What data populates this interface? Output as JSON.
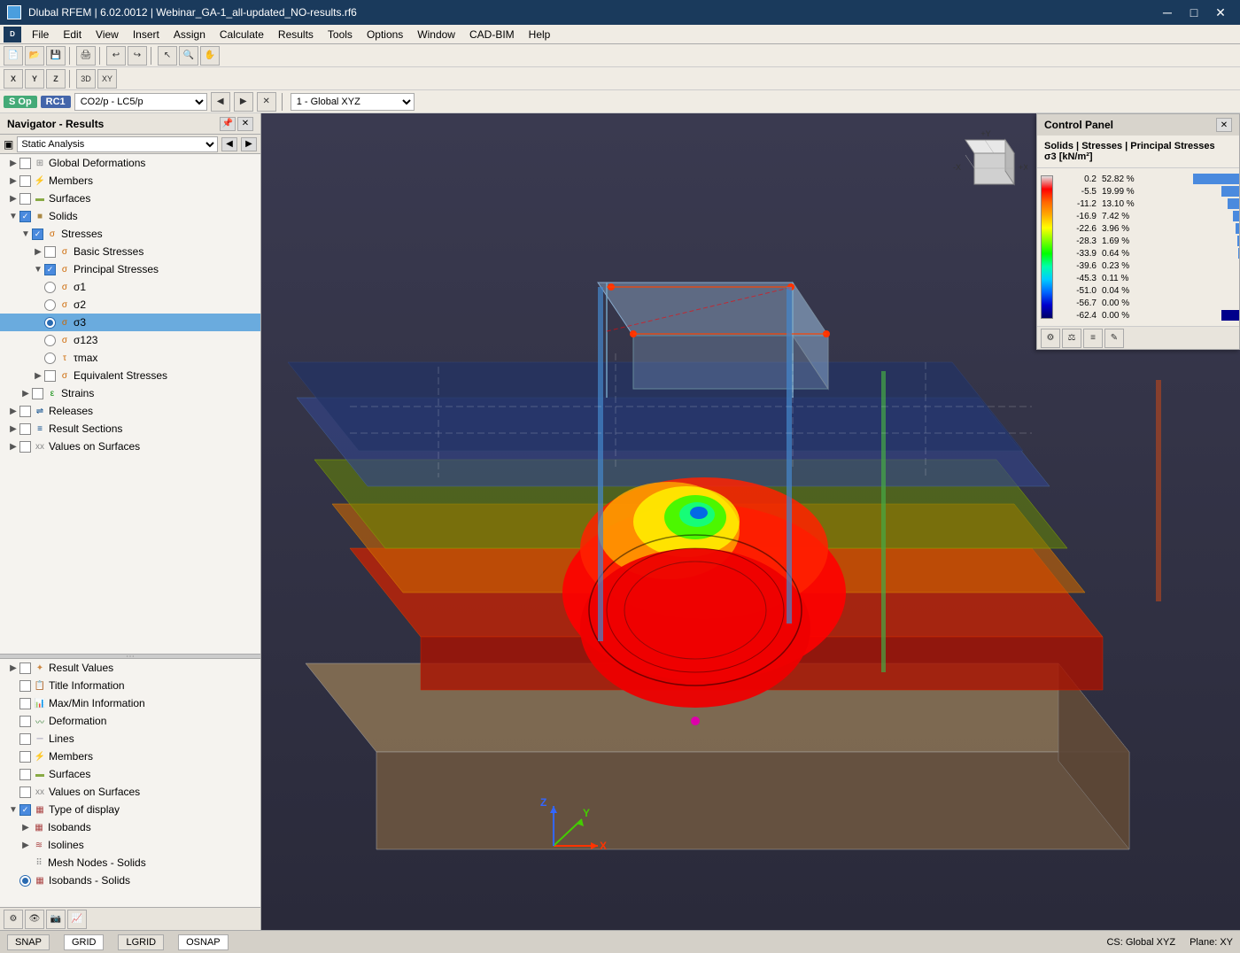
{
  "titlebar": {
    "title": "Dlubal RFEM | 6.02.0012 | Webinar_GA-1_all-updated_NO-results.rf6",
    "icon": "rfem-icon"
  },
  "menubar": {
    "items": [
      "File",
      "Edit",
      "View",
      "Insert",
      "Assign",
      "Calculate",
      "Results",
      "Tools",
      "Options",
      "Window",
      "CAD-BIM",
      "Help"
    ]
  },
  "status_toolbar": {
    "s_op": "S Op",
    "rc1": "RC1",
    "combo": "CO2/p - LC5/p",
    "global_xyz": "1 - Global XYZ"
  },
  "navigator": {
    "title": "Navigator - Results",
    "dropdown": "Static Analysis",
    "tree": [
      {
        "id": "global-def",
        "label": "Global Deformations",
        "indent": 1,
        "type": "checkbox",
        "checked": false,
        "icon": "grid"
      },
      {
        "id": "members",
        "label": "Members",
        "indent": 1,
        "type": "checkbox",
        "checked": false,
        "icon": "members"
      },
      {
        "id": "surfaces",
        "label": "Surfaces",
        "indent": 1,
        "type": "checkbox",
        "checked": false,
        "icon": "surface"
      },
      {
        "id": "solids",
        "label": "Solids",
        "indent": 1,
        "type": "checkbox",
        "checked": true,
        "icon": "solid",
        "expanded": true
      },
      {
        "id": "stresses",
        "label": "Stresses",
        "indent": 2,
        "type": "checkbox",
        "checked": true,
        "icon": "stress",
        "expanded": true
      },
      {
        "id": "basic-stress",
        "label": "Basic Stresses",
        "indent": 3,
        "type": "checkbox",
        "checked": false,
        "icon": "stress"
      },
      {
        "id": "principal-stress",
        "label": "Principal Stresses",
        "indent": 3,
        "type": "checkbox",
        "checked": true,
        "icon": "stress",
        "expanded": true
      },
      {
        "id": "s1",
        "label": "σ1",
        "indent": 4,
        "type": "radio",
        "checked": false,
        "icon": "stress"
      },
      {
        "id": "s2",
        "label": "σ2",
        "indent": 4,
        "type": "radio",
        "checked": false,
        "icon": "stress"
      },
      {
        "id": "s3",
        "label": "σ3",
        "indent": 4,
        "type": "radio",
        "checked": true,
        "icon": "stress"
      },
      {
        "id": "s123",
        "label": "σ123",
        "indent": 4,
        "type": "radio",
        "checked": false,
        "icon": "stress"
      },
      {
        "id": "tmax",
        "label": "τmax",
        "indent": 4,
        "type": "radio",
        "checked": false,
        "icon": "stress"
      },
      {
        "id": "equiv-stress",
        "label": "Equivalent Stresses",
        "indent": 3,
        "type": "checkbox",
        "checked": false,
        "icon": "stress"
      },
      {
        "id": "strains",
        "label": "Strains",
        "indent": 2,
        "type": "checkbox",
        "checked": false,
        "icon": "strain"
      },
      {
        "id": "releases",
        "label": "Releases",
        "indent": 1,
        "type": "checkbox",
        "checked": false,
        "icon": "result"
      },
      {
        "id": "result-sections",
        "label": "Result Sections",
        "indent": 1,
        "type": "checkbox",
        "checked": false,
        "icon": "result"
      },
      {
        "id": "values-on-surfaces",
        "label": "Values on Surfaces",
        "indent": 1,
        "type": "checkbox",
        "checked": false,
        "icon": "result"
      }
    ],
    "bottom_tree": [
      {
        "id": "result-values",
        "label": "Result Values",
        "indent": 1,
        "type": "checkbox",
        "checked": false,
        "icon": "result"
      },
      {
        "id": "title-info",
        "label": "Title Information",
        "indent": 1,
        "type": "checkbox",
        "checked": false,
        "icon": "title"
      },
      {
        "id": "maxmin-info",
        "label": "Max/Min Information",
        "indent": 1,
        "type": "checkbox",
        "checked": false,
        "icon": "info"
      },
      {
        "id": "deformation",
        "label": "Deformation",
        "indent": 1,
        "type": "checkbox",
        "checked": false,
        "icon": "deform"
      },
      {
        "id": "lines",
        "label": "Lines",
        "indent": 1,
        "type": "checkbox",
        "checked": false,
        "icon": "lines"
      },
      {
        "id": "members-b",
        "label": "Members",
        "indent": 1,
        "type": "checkbox",
        "checked": false,
        "icon": "members"
      },
      {
        "id": "surfaces-b",
        "label": "Surfaces",
        "indent": 1,
        "type": "checkbox",
        "checked": false,
        "icon": "surface"
      },
      {
        "id": "values-on-surfaces-b",
        "label": "Values on Surfaces",
        "indent": 1,
        "type": "checkbox",
        "checked": false,
        "icon": "result"
      },
      {
        "id": "type-of-display",
        "label": "Type of display",
        "indent": 1,
        "type": "checkbox",
        "checked": true,
        "icon": "display",
        "expanded": true
      },
      {
        "id": "isobands",
        "label": "Isobands",
        "indent": 2,
        "type": "item",
        "icon": "isoband"
      },
      {
        "id": "isolines",
        "label": "Isolines",
        "indent": 2,
        "type": "item",
        "icon": "isoline"
      },
      {
        "id": "mesh-nodes-solids",
        "label": "Mesh Nodes - Solids",
        "indent": 2,
        "type": "item",
        "icon": "mesh"
      },
      {
        "id": "isobands-solids",
        "label": "Isobands - Solids",
        "indent": 2,
        "type": "radio",
        "checked": true,
        "icon": "isoband"
      }
    ]
  },
  "control_panel": {
    "title": "Control Panel",
    "subtitle": "Solids | Stresses | Principal Stresses",
    "unit": "σ3 [kN/m²]",
    "legend": [
      {
        "value": "0.2",
        "color": "#e0e0e0",
        "pct": "52.82 %",
        "bar": 52
      },
      {
        "value": "-5.5",
        "color": "#ff0000",
        "pct": "19.99 %",
        "bar": 20
      },
      {
        "value": "-11.2",
        "color": "#ff6600",
        "pct": "13.10 %",
        "bar": 13
      },
      {
        "value": "-16.9",
        "color": "#ffaa00",
        "pct": "7.42 %",
        "bar": 7
      },
      {
        "value": "-22.6",
        "color": "#ffff00",
        "pct": "3.96 %",
        "bar": 4
      },
      {
        "value": "-28.3",
        "color": "#80ff00",
        "pct": "1.69 %",
        "bar": 2
      },
      {
        "value": "-33.9",
        "color": "#00ff00",
        "pct": "0.64 %",
        "bar": 1
      },
      {
        "value": "-39.6",
        "color": "#00ffaa",
        "pct": "0.23 %",
        "bar": 0
      },
      {
        "value": "-45.3",
        "color": "#00ccff",
        "pct": "0.11 %",
        "bar": 0
      },
      {
        "value": "-51.0",
        "color": "#0066ff",
        "pct": "0.04 %",
        "bar": 0
      },
      {
        "value": "-56.7",
        "color": "#0000cc",
        "pct": "0.00 %",
        "bar": 0
      },
      {
        "value": "-62.4",
        "color": "#000066",
        "pct": "0.00 %",
        "bar": 0
      }
    ]
  },
  "status_bar": {
    "snap": "SNAP",
    "grid": "GRID",
    "lgrid": "LGRID",
    "osnap": "OSNAP",
    "cs": "CS: Global XYZ",
    "plane": "Plane: XY"
  }
}
